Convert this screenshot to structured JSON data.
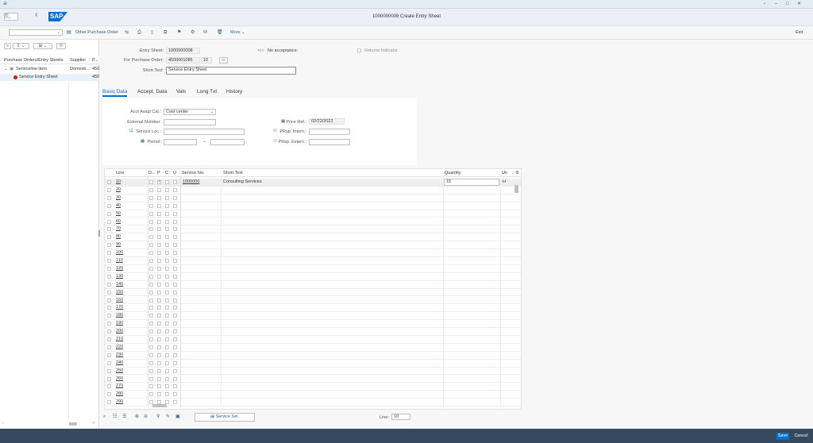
{
  "window": {
    "title": "1000000008 Create Entry Sheet",
    "menu_icon": "hamburger-icon"
  },
  "shell": {
    "back_icon": "back-arrow-icon",
    "logo": "SAP"
  },
  "toolbar": {
    "other_po_label": "Other Purchase Order",
    "more_label": "More",
    "exit_label": "Exit"
  },
  "left": {
    "columns": [
      "Purchase Orders/Entry Sheets",
      "Supplier",
      "P..."
    ],
    "rows": [
      {
        "label": "Serviceline item",
        "supplier": "Domesti...",
        "p": "450"
      },
      {
        "label": "Service Entry Sheet",
        "supplier": "",
        "p": "450"
      }
    ]
  },
  "header": {
    "entry_sheet_label": "Entry Sheet:",
    "entry_sheet_value": "1000000008",
    "po_label": "For Purchase Order:",
    "po_value": "4500001085",
    "po_item": "10",
    "short_text_label": "Short Text:",
    "short_text_value": "Service Entry Sheet",
    "acceptance_label": "No acceptance:",
    "returns_label": "Returns Indicator"
  },
  "tabs": [
    "Basic Data",
    "Accept. Data",
    "Vals",
    "Long Txt",
    "History"
  ],
  "basic": {
    "acct_label": "Acct Assgt Cat.:",
    "acct_value": "Cost center",
    "ext_label": "External Number:",
    "svc_loc_label": "Service Loc.:",
    "period_label": "Period:",
    "period_sep": "–",
    "price_ref_label": "Price Ref.:",
    "price_ref_value": "02/22/2022",
    "prsp_int_label": "PRsp. Intern.:",
    "prsp_ext_label": "PRsp. Extern.:"
  },
  "grid": {
    "columns": [
      "Line",
      "D...",
      "P",
      "C",
      "U",
      "Service No.",
      "Short Text",
      "Quantity",
      "Un"
    ],
    "first_row": {
      "service_no": "1000000",
      "short_text": "Consulting Services",
      "quantity": "15",
      "unit": "H"
    },
    "lines": [
      "10",
      "20",
      "30",
      "40",
      "50",
      "60",
      "70",
      "80",
      "90",
      "100",
      "110",
      "120",
      "130",
      "140",
      "150",
      "160",
      "170",
      "180",
      "190",
      "200",
      "210",
      "220",
      "230",
      "240",
      "250",
      "260",
      "270",
      "280",
      "290"
    ]
  },
  "bottom": {
    "service_sel_label": "Service Sel.",
    "line_label": "Line:",
    "line_value": "10"
  },
  "footer": {
    "save_label": "Save",
    "cancel_label": "Cancel"
  },
  "colors": {
    "accent": "#0a6ed1",
    "footer": "#354a5f",
    "sap_blue": "#0a6ed1",
    "ack_red": "#cc1919"
  }
}
